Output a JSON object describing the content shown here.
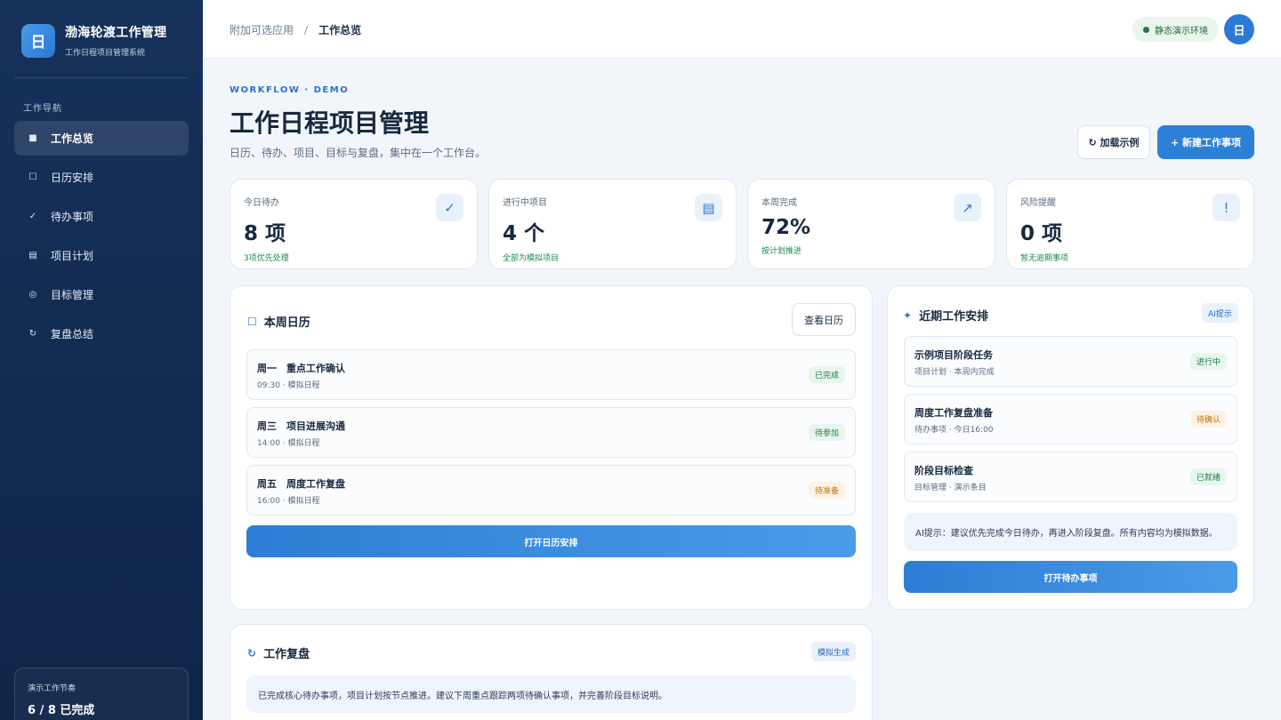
{
  "app": {
    "logo_char": "日",
    "title": "渤海轮渡工作管理",
    "subtitle": "工作日程项目管理系统"
  },
  "sidebar": {
    "heading": "工作导航",
    "items": [
      {
        "icon": "■",
        "label": "工作总览",
        "active": true
      },
      {
        "icon": "☐",
        "label": "日历安排"
      },
      {
        "icon": "✓",
        "label": "待办事项"
      },
      {
        "icon": "▤",
        "label": "项目计划"
      },
      {
        "icon": "◎",
        "label": "目标管理"
      },
      {
        "icon": "↻",
        "label": "复盘总结"
      }
    ],
    "rhythm": {
      "label": "演示工作节奏",
      "value": "6 / 8 已完成"
    }
  },
  "topbar": {
    "breadcrumb_parent": "附加可选应用",
    "breadcrumb_sep": "/",
    "breadcrumb_current": "工作总览",
    "env_badge": "静态演示环境",
    "avatar": "日"
  },
  "header": {
    "eyebrow": "WORKFLOW · DEMO",
    "title": "工作日程项目管理",
    "subtitle": "日历、待办、项目、目标与复盘，集中在一个工作台。",
    "load_sample": "↻ 加载示例",
    "new_item": "+ 新建工作事项"
  },
  "stats": [
    {
      "label": "今日待办",
      "value": "8 项",
      "note": "3项优先处理",
      "icon": "✓"
    },
    {
      "label": "进行中项目",
      "value": "4 个",
      "note": "全部为模拟项目",
      "icon": "▤"
    },
    {
      "label": "本周完成",
      "value": "72%",
      "note": "按计划推进",
      "icon": "↗"
    },
    {
      "label": "风险提醒",
      "value": "0 项",
      "note": "暂无逾期事项",
      "icon": "!"
    }
  ],
  "calendar": {
    "icon": "☐",
    "title": "本周日历",
    "view_button": "查看日历",
    "rows": [
      {
        "title": "周一　重点工作确认",
        "meta": "09:30 · 模拟日程",
        "tag": "已完成",
        "tone": "green"
      },
      {
        "title": "周三　项目进展沟通",
        "meta": "14:00 · 模拟日程",
        "tag": "待参加",
        "tone": "green"
      },
      {
        "title": "周五　周度工作复盘",
        "meta": "16:00 · 模拟日程",
        "tag": "待准备",
        "tone": "orange"
      }
    ],
    "open_button": "打开日历安排"
  },
  "recent": {
    "icon": "✦",
    "title": "近期工作安排",
    "badge": "AI提示",
    "rows": [
      {
        "title": "示例项目阶段任务",
        "meta": "项目计划 · 本周内完成",
        "tag": "进行中",
        "tone": "green"
      },
      {
        "title": "周度工作复盘准备",
        "meta": "待办事项 · 今日16:00",
        "tag": "待确认",
        "tone": "orange"
      },
      {
        "title": "阶段目标检查",
        "meta": "目标管理 · 演示条目",
        "tag": "已就绪",
        "tone": "green"
      }
    ],
    "hint": "AI提示：建议优先完成今日待办，再进入阶段复盘。所有内容均为模拟数据。",
    "open_button": "打开待办事项"
  },
  "review": {
    "icon": "↻",
    "title": "工作复盘",
    "badge": "模拟生成",
    "text": "已完成核心待办事项，项目计划按节点推进。建议下周重点跟踪两项待确认事项，并完善阶段目标说明。"
  }
}
